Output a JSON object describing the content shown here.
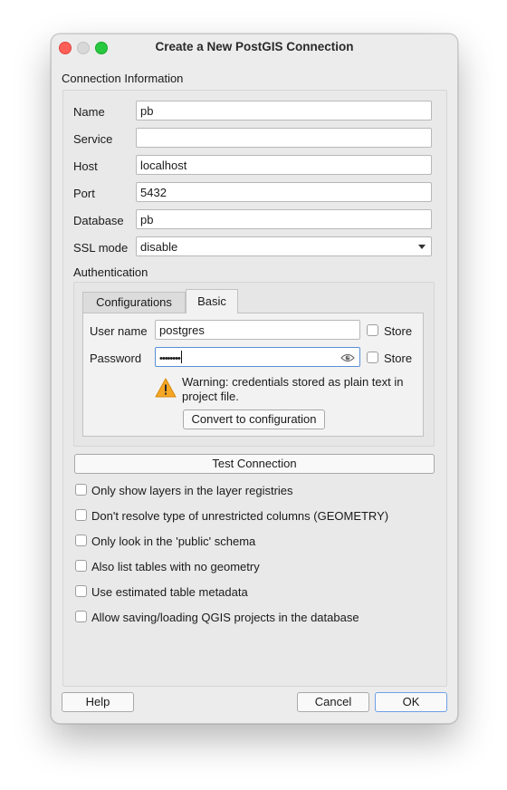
{
  "window": {
    "title": "Create a New PostGIS Connection"
  },
  "connection_info": {
    "label": "Connection Information",
    "fields": [
      {
        "label": "Name",
        "value": "pb"
      },
      {
        "label": "Service",
        "value": ""
      },
      {
        "label": "Host",
        "value": "localhost"
      },
      {
        "label": "Port",
        "value": "5432"
      },
      {
        "label": "Database",
        "value": "pb"
      }
    ],
    "ssl_mode": {
      "label": "SSL mode",
      "value": "disable"
    }
  },
  "authentication": {
    "label": "Authentication",
    "tabs": [
      {
        "label": "Configurations",
        "active": false
      },
      {
        "label": "Basic",
        "active": true
      }
    ],
    "username": {
      "label": "User name",
      "value": "postgres",
      "store_label": "Store",
      "store_checked": false
    },
    "password": {
      "label": "Password",
      "masked_value": "••••••••",
      "store_label": "Store",
      "store_checked": false
    },
    "warning": {
      "line1": "Warning: credentials stored as plain text in",
      "line2": "project file.",
      "icon": "warning-icon"
    },
    "convert_button": "Convert to configuration"
  },
  "test_connection_button": "Test Connection",
  "options": [
    {
      "label": "Only show layers in the layer registries",
      "checked": false
    },
    {
      "label": "Don't resolve type of unrestricted columns (GEOMETRY)",
      "checked": false
    },
    {
      "label": "Only look in the 'public' schema",
      "checked": false
    },
    {
      "label": "Also list tables with no geometry",
      "checked": false
    },
    {
      "label": "Use estimated table metadata",
      "checked": false
    },
    {
      "label": "Allow saving/loading QGIS projects in the database",
      "checked": false
    }
  ],
  "footer": {
    "help": "Help",
    "cancel": "Cancel",
    "ok": "OK"
  },
  "colors": {
    "close": "#ff5f57",
    "minimize": "#d8d8d8",
    "maximize": "#28c840",
    "focus": "#5a8fd6",
    "warning": "#f5a623"
  }
}
